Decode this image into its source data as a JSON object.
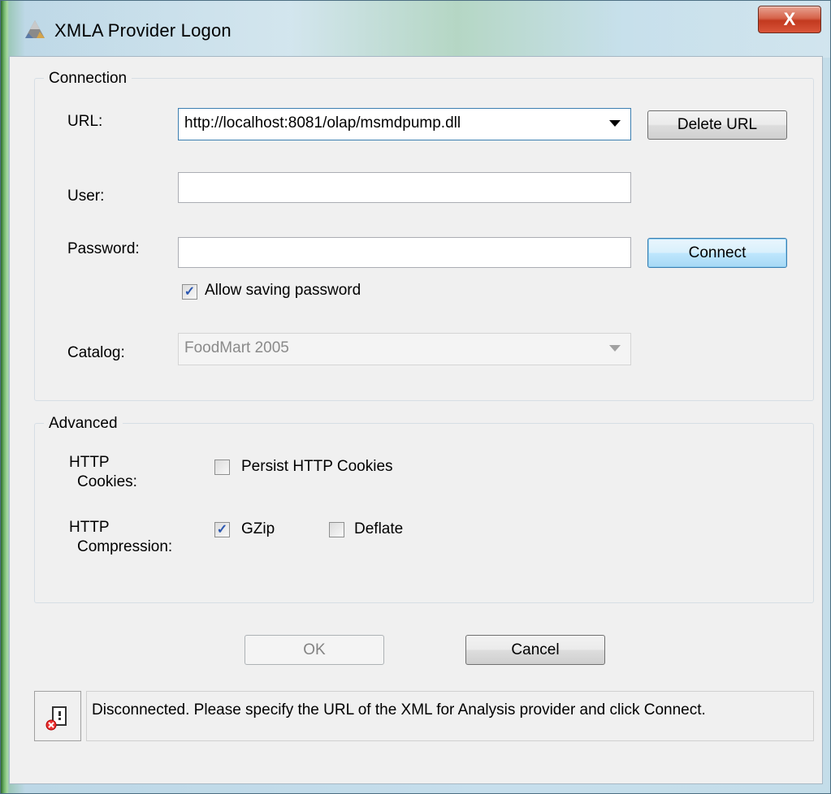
{
  "window": {
    "title": "XMLA Provider Logon",
    "close_glyph": "X"
  },
  "connection": {
    "group_title": "Connection",
    "url_label": "URL:",
    "url_value": "http://localhost:8081/olap/msmdpump.dll",
    "delete_url_label": "Delete URL",
    "user_label": "User:",
    "user_value": "",
    "password_label": "Password:",
    "password_value": "",
    "connect_label": "Connect",
    "allow_saving_label": "Allow saving password",
    "allow_saving_checked": true,
    "catalog_label": "Catalog:",
    "catalog_value": "FoodMart 2005"
  },
  "advanced": {
    "group_title": "Advanced",
    "cookies_label_line1": "HTTP",
    "cookies_label_line2": "Cookies:",
    "persist_cookies_label": "Persist HTTP Cookies",
    "persist_cookies_checked": false,
    "compression_label_line1": "HTTP",
    "compression_label_line2": "Compression:",
    "gzip_label": "GZip",
    "gzip_checked": true,
    "deflate_label": "Deflate",
    "deflate_checked": false
  },
  "buttons": {
    "ok_label": "OK",
    "cancel_label": "Cancel"
  },
  "status": {
    "icon": "disconnected-icon",
    "message": "Disconnected. Please specify the URL of the XML for Analysis provider and click Connect."
  },
  "icons": {
    "app": "xmla-logo-icon",
    "check_mark": "✓"
  }
}
